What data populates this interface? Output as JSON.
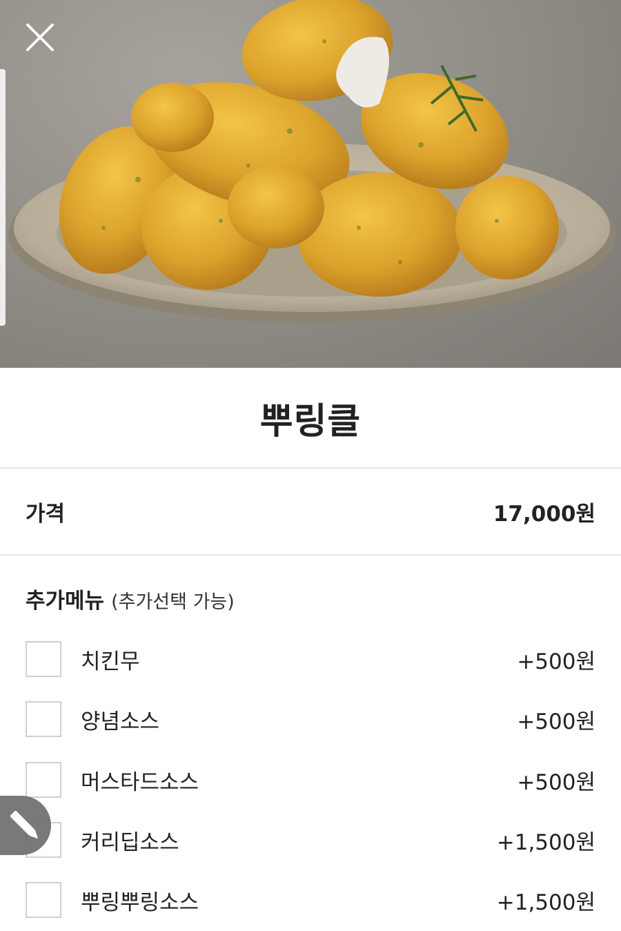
{
  "product": {
    "name": "뿌링클",
    "price_label": "가격",
    "price_value": "17,000원"
  },
  "extras": {
    "title": "추가메뉴",
    "note": "(추가선택 가능)",
    "options": [
      {
        "label": "치킨무",
        "price": "+500원",
        "checked": false
      },
      {
        "label": "양념소스",
        "price": "+500원",
        "checked": false
      },
      {
        "label": "머스타드소스",
        "price": "+500원",
        "checked": false
      },
      {
        "label": "커리딥소스",
        "price": "+1,500원",
        "checked": false
      },
      {
        "label": "뿌링뿌링소스",
        "price": "+1,500원",
        "checked": false
      }
    ]
  },
  "icons": {
    "close": "close-icon",
    "edit": "pencil-icon"
  },
  "colors": {
    "divider": "#e6e6e6",
    "checkbox_border": "#d0d0d0",
    "fab": "#6e6e6e"
  }
}
